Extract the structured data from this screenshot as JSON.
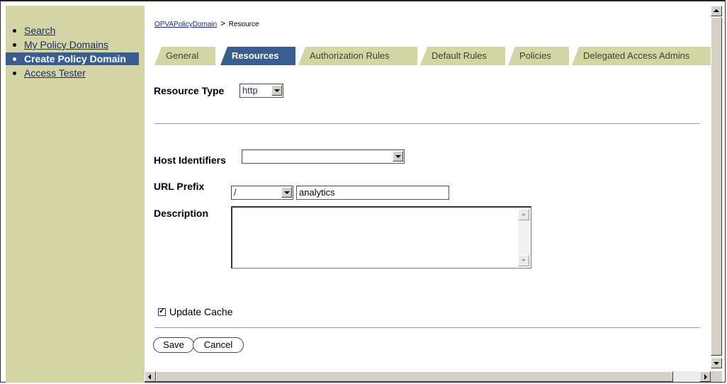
{
  "nav": {
    "items": [
      {
        "label": "Search",
        "active": false
      },
      {
        "label": "My Policy Domains",
        "active": false
      },
      {
        "label": "Create Policy Domain",
        "active": true
      },
      {
        "label": "Access Tester",
        "active": false
      }
    ]
  },
  "breadcrumb": {
    "link": "OPVAPolicyDomain",
    "separator": ">",
    "current": "Resource"
  },
  "tabs": [
    {
      "label": "General",
      "active": false
    },
    {
      "label": "Resources",
      "active": true
    },
    {
      "label": "Authorization Rules",
      "active": false
    },
    {
      "label": "Default Rules",
      "active": false
    },
    {
      "label": "Policies",
      "active": false
    },
    {
      "label": "Delegated Access Admins",
      "active": false
    }
  ],
  "form": {
    "resource_type_label": "Resource Type",
    "resource_type_value": "http",
    "host_identifiers_label": "Host Identifiers",
    "host_identifiers_value": "",
    "url_prefix_label": "URL Prefix",
    "url_prefix_select": "/",
    "url_prefix_value": "analytics",
    "description_label": "Description",
    "description_value": "",
    "update_cache_label": "Update Cache",
    "update_cache_checked": true
  },
  "buttons": {
    "save": "Save",
    "cancel": "Cancel"
  },
  "colors": {
    "nav_bg": "#d3d6a4",
    "accent": "#3a5d8f",
    "link": "#1c2a7a"
  }
}
